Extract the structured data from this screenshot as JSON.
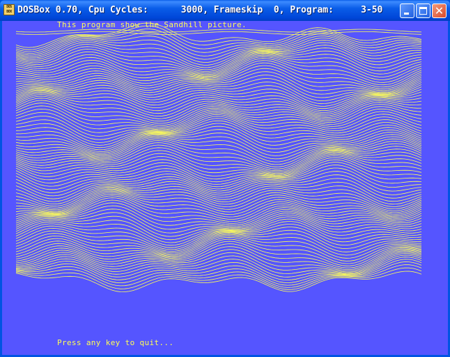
{
  "window": {
    "title": "DOSBox 0.70, Cpu Cycles:      3000, Frameskip  0, Program:     3-50",
    "icon_text": "DOS BOX",
    "buttons": {
      "minimize": "minimize-icon",
      "maximize": "maximize-icon",
      "close": "close-icon"
    },
    "close_glyph": "✕"
  },
  "screen": {
    "background": "#5555FF",
    "foreground": "#FFFF55",
    "header": "This program show the Sandhill picture.",
    "footer": "Press any key to quit..."
  }
}
